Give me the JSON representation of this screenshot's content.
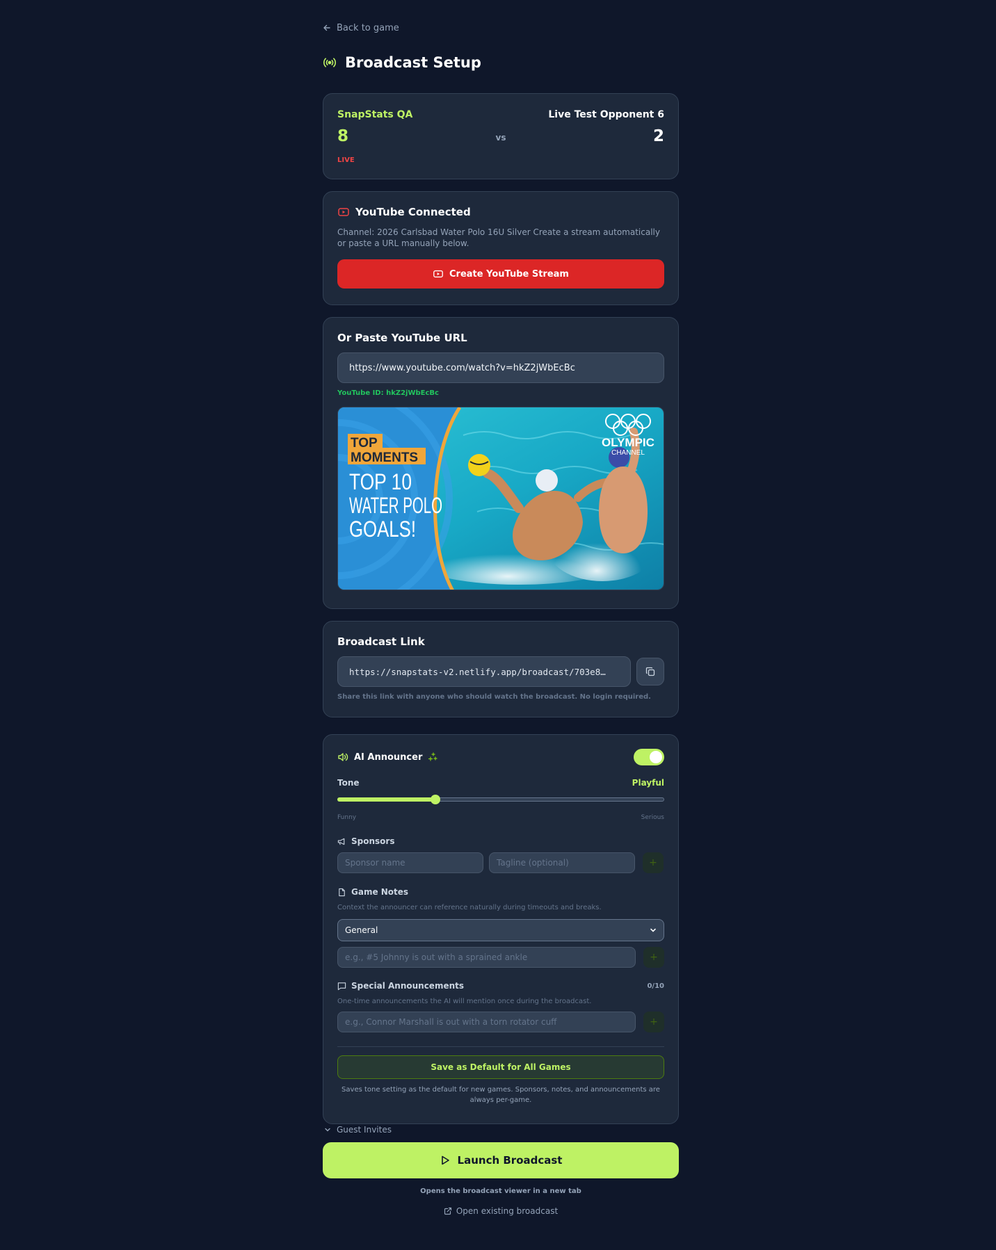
{
  "nav": {
    "back_label": "Back to game"
  },
  "page": {
    "title": "Broadcast Setup"
  },
  "score": {
    "home_team": "SnapStats QA",
    "home_score": "8",
    "away_team": "Live Test Opponent 6",
    "away_score": "2",
    "vs": "vs",
    "status": "LIVE"
  },
  "youtube": {
    "title": "YouTube Connected",
    "description": "Channel: 2026 Carlsbad Water Polo 16U Silver Create a stream automatically or paste a URL manually below.",
    "create_button": "Create YouTube Stream"
  },
  "paste": {
    "title": "Or Paste YouTube URL",
    "url_value": "https://www.youtube.com/watch?v=hkZ2jWbEcBc",
    "youtube_id": "YouTube ID: hkZ2jWbEcBc",
    "thumbnail": {
      "badge_top": "TOP",
      "badge_bottom": "MOMENTS",
      "line1": "TOP 10",
      "line2": "WATER POLO",
      "line3": "GOALS!",
      "brand": "OLYMPIC",
      "brand_sub": "CHANNEL"
    }
  },
  "broadcast_link": {
    "title": "Broadcast Link",
    "url": "https://snapstats-v2.netlify.app/broadcast/703e8…",
    "hint": "Share this link with anyone who should watch the broadcast. No login required."
  },
  "announcer": {
    "title": "AI Announcer",
    "enabled": true,
    "tone_label": "Tone",
    "tone_value": "Playful",
    "tone_level": 0.3,
    "tone_min": "Funny",
    "tone_max": "Serious",
    "sponsors": {
      "title": "Sponsors",
      "name_placeholder": "Sponsor name",
      "tagline_placeholder": "Tagline (optional)",
      "add": "+"
    },
    "notes": {
      "title": "Game Notes",
      "description": "Context the announcer can reference naturally during timeouts and breaks.",
      "category": "General",
      "placeholder": "e.g., #5 Johnny is out with a sprained ankle",
      "add": "+"
    },
    "special": {
      "title": "Special Announcements",
      "count": "0/10",
      "description": "One-time announcements the AI will mention once during the broadcast.",
      "placeholder": "e.g., Connor Marshall is out with a torn rotator cuff",
      "add": "+"
    },
    "save_button": "Save as Default for All Games",
    "save_hint": "Saves tone setting as the default for new games. Sponsors, notes, and announcements are always per-game."
  },
  "guest_invites": {
    "label": "Guest Invites"
  },
  "launch": {
    "button": "Launch Broadcast",
    "hint": "Opens the broadcast viewer in a new tab",
    "open_existing": "Open existing broadcast"
  },
  "colors": {
    "background": "#0f172a",
    "card": "#1e293b",
    "accent": "#bef264",
    "youtube_red": "#dc2626",
    "live_red": "#ef4444",
    "success_green": "#22c55e"
  }
}
